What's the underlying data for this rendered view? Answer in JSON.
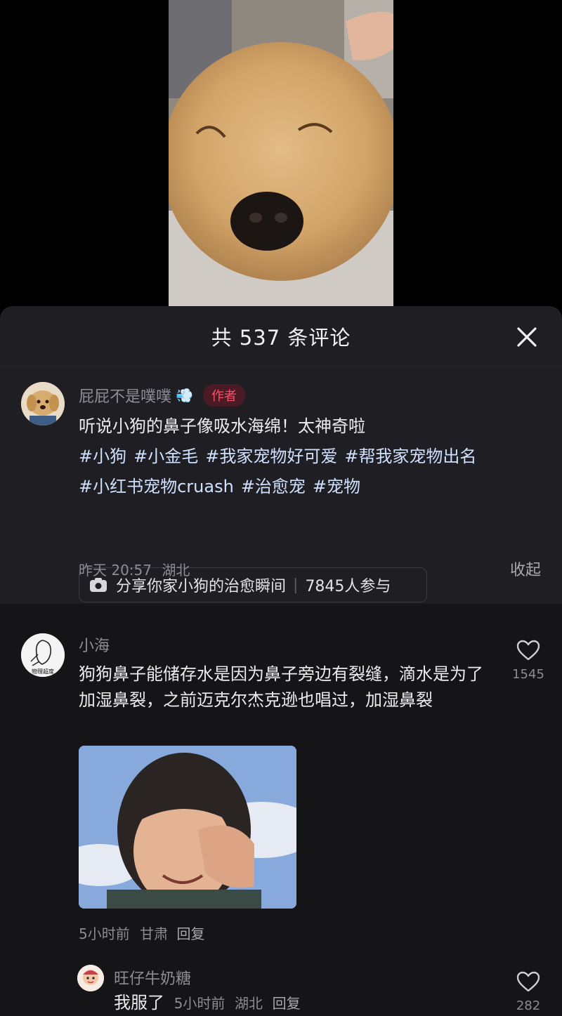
{
  "header": {
    "title": "共 537 条评论"
  },
  "post": {
    "author": "屁屁不是噗噗",
    "author_emoji": "💨",
    "author_badge": "作者",
    "text": "听说小狗的鼻子像吸水海绵！太神奇啦",
    "tags": [
      "#小狗",
      "#小金毛",
      "#我家宠物好可爱",
      "#帮我家宠物出名",
      "#小红书宠物cruash",
      "#治愈宠",
      "#宠物"
    ],
    "topic": {
      "label": "分享你家小狗的治愈瞬间",
      "participants": "7845人参与"
    },
    "time": "昨天 20:57",
    "location": "湖北",
    "collapse_label": "收起"
  },
  "comments": [
    {
      "author": "小海",
      "text": "狗狗鼻子能储存水是因为鼻子旁边有裂缝，滴水是为了加湿鼻裂，之前迈克尔杰克逊也唱过，加湿鼻裂",
      "time": "5小时前",
      "location": "甘肃",
      "reply_label": "回复",
      "likes": "1545",
      "avatar_caption": "物理超度"
    },
    {
      "author": "旺仔牛奶糖",
      "text": "我服了",
      "time": "5小时前",
      "location": "湖北",
      "reply_label": "回复",
      "likes": "282"
    }
  ],
  "icons": {
    "close": "close-icon",
    "heart": "heart-icon",
    "camera": "camera-icon"
  }
}
